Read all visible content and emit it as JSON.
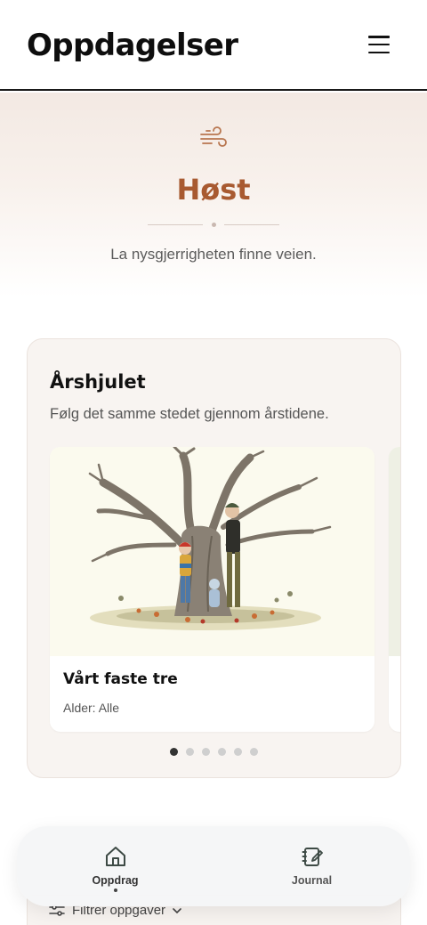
{
  "header": {
    "title": "Oppdagelser",
    "menu_icon": "hamburger-menu-icon"
  },
  "hero": {
    "icon": "wind-icon",
    "season": "Høst",
    "subtitle": "La nysgjerrigheten finne veien.",
    "accent_color": "#a85a31"
  },
  "year_wheel": {
    "title": "Årshjulet",
    "subtitle": "Følg det samme stedet gjennom årstidene.",
    "items": [
      {
        "title": "Vårt faste tre",
        "meta": "Alder: Alle",
        "image": "tree-illustration"
      }
    ],
    "pagination": {
      "total": 6,
      "active": 1
    }
  },
  "filter": {
    "label": "Filtrer oppgaver",
    "icon": "sliders-icon"
  },
  "bottom_nav": {
    "items": [
      {
        "label": "Oppdrag",
        "icon": "home-icon",
        "active": true
      },
      {
        "label": "Journal",
        "icon": "journal-icon",
        "active": false
      }
    ]
  }
}
